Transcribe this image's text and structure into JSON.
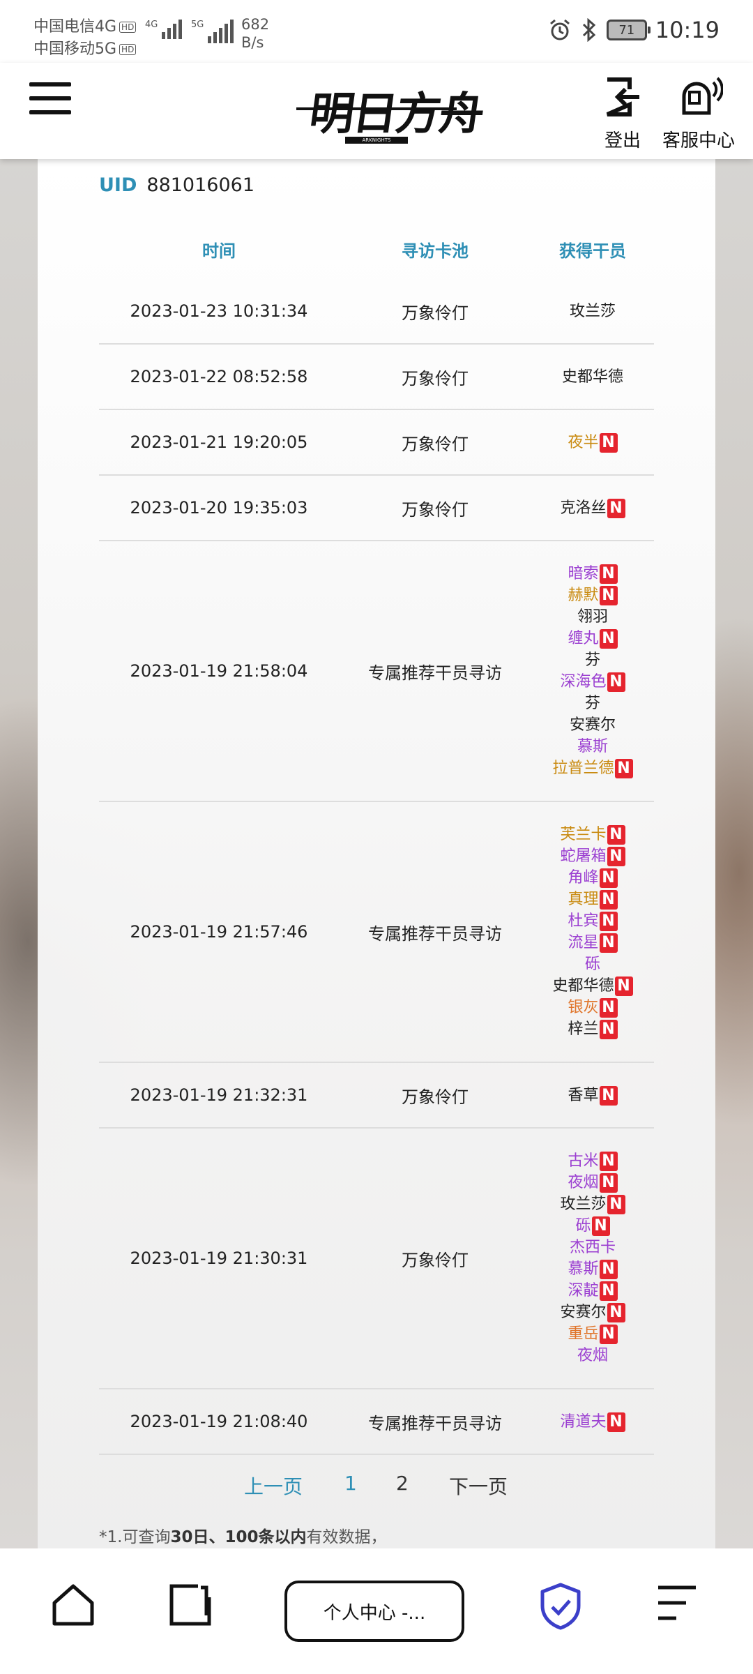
{
  "status_bar": {
    "carrier1": "中国电信4G",
    "carrier2": "中国移动5G",
    "hd": "HD",
    "net1": "4G",
    "net2": "5G",
    "speed_value": "682",
    "speed_unit": "B/s",
    "battery": "71",
    "time": "10:19"
  },
  "header": {
    "logo_text": "明日方舟",
    "logo_sub": "ARKNIGHTS",
    "logout_label": "登出",
    "service_label": "客服中心"
  },
  "uid": {
    "label": "UID",
    "value": "881016061"
  },
  "table": {
    "headers": [
      "时间",
      "寻访卡池",
      "获得干员"
    ],
    "new_badge": "N",
    "rows": [
      {
        "time": "2023-01-23 10:31:34",
        "pool": "万象伶仃",
        "ops": [
          {
            "name": "玫兰莎",
            "color": "#222222",
            "new": false
          }
        ]
      },
      {
        "time": "2023-01-22 08:52:58",
        "pool": "万象伶仃",
        "ops": [
          {
            "name": "史都华德",
            "color": "#222222",
            "new": false
          }
        ]
      },
      {
        "time": "2023-01-21 19:20:05",
        "pool": "万象伶仃",
        "ops": [
          {
            "name": "夜半",
            "color": "#c98a10",
            "new": true
          }
        ]
      },
      {
        "time": "2023-01-20 19:35:03",
        "pool": "万象伶仃",
        "ops": [
          {
            "name": "克洛丝",
            "color": "#222222",
            "new": true
          }
        ]
      },
      {
        "time": "2023-01-19 21:58:04",
        "pool": "专属推荐干员寻访",
        "ops": [
          {
            "name": "暗索",
            "color": "#9b3fd1",
            "new": true
          },
          {
            "name": "赫默",
            "color": "#c98a10",
            "new": true
          },
          {
            "name": "翎羽",
            "color": "#222222",
            "new": false
          },
          {
            "name": "缠丸",
            "color": "#9b3fd1",
            "new": true
          },
          {
            "name": "芬",
            "color": "#222222",
            "new": false
          },
          {
            "name": "深海色",
            "color": "#9b3fd1",
            "new": true
          },
          {
            "name": "芬",
            "color": "#222222",
            "new": false
          },
          {
            "name": "安赛尔",
            "color": "#222222",
            "new": false
          },
          {
            "name": "慕斯",
            "color": "#9b3fd1",
            "new": false
          },
          {
            "name": "拉普兰德",
            "color": "#c98a10",
            "new": true
          }
        ]
      },
      {
        "time": "2023-01-19 21:57:46",
        "pool": "专属推荐干员寻访",
        "ops": [
          {
            "name": "芙兰卡",
            "color": "#c98a10",
            "new": true
          },
          {
            "name": "蛇屠箱",
            "color": "#9b3fd1",
            "new": true
          },
          {
            "name": "角峰",
            "color": "#9b3fd1",
            "new": true
          },
          {
            "name": "真理",
            "color": "#c98a10",
            "new": true
          },
          {
            "name": "杜宾",
            "color": "#9b3fd1",
            "new": true
          },
          {
            "name": "流星",
            "color": "#9b3fd1",
            "new": true
          },
          {
            "name": "砾",
            "color": "#9b3fd1",
            "new": false
          },
          {
            "name": "史都华德",
            "color": "#222222",
            "new": true
          },
          {
            "name": "银灰",
            "color": "#e0742a",
            "new": true
          },
          {
            "name": "梓兰",
            "color": "#222222",
            "new": true
          }
        ]
      },
      {
        "time": "2023-01-19 21:32:31",
        "pool": "万象伶仃",
        "ops": [
          {
            "name": "香草",
            "color": "#222222",
            "new": true
          }
        ]
      },
      {
        "time": "2023-01-19 21:30:31",
        "pool": "万象伶仃",
        "ops": [
          {
            "name": "古米",
            "color": "#9b3fd1",
            "new": true
          },
          {
            "name": "夜烟",
            "color": "#9b3fd1",
            "new": true
          },
          {
            "name": "玫兰莎",
            "color": "#222222",
            "new": true
          },
          {
            "name": "砾",
            "color": "#9b3fd1",
            "new": true
          },
          {
            "name": "杰西卡",
            "color": "#9b3fd1",
            "new": false
          },
          {
            "name": "慕斯",
            "color": "#9b3fd1",
            "new": true
          },
          {
            "name": "深靛",
            "color": "#9b3fd1",
            "new": true
          },
          {
            "name": "安赛尔",
            "color": "#222222",
            "new": true
          },
          {
            "name": "重岳",
            "color": "#e0742a",
            "new": true
          },
          {
            "name": "夜烟",
            "color": "#9b3fd1",
            "new": false
          }
        ]
      },
      {
        "time": "2023-01-19 21:08:40",
        "pool": "专属推荐干员寻访",
        "ops": [
          {
            "name": "清道夫",
            "color": "#9b3fd1",
            "new": true
          }
        ]
      }
    ]
  },
  "pager": {
    "prev": "上一页",
    "page1": "1",
    "page2": "2",
    "next": "下一页"
  },
  "note": {
    "prefix": "*1.可查询",
    "bold": "30日、100条以内",
    "suffix": "有效数据，"
  },
  "bottom_bar": {
    "tab_label": "个人中心 -..."
  },
  "colors": {
    "accent": "#2e8fb5",
    "new_badge": "#e5242e",
    "six_star": "#e0742a",
    "five_star": "#c98a10",
    "four_star": "#9b3fd1",
    "shield": "#3b3fc9"
  }
}
